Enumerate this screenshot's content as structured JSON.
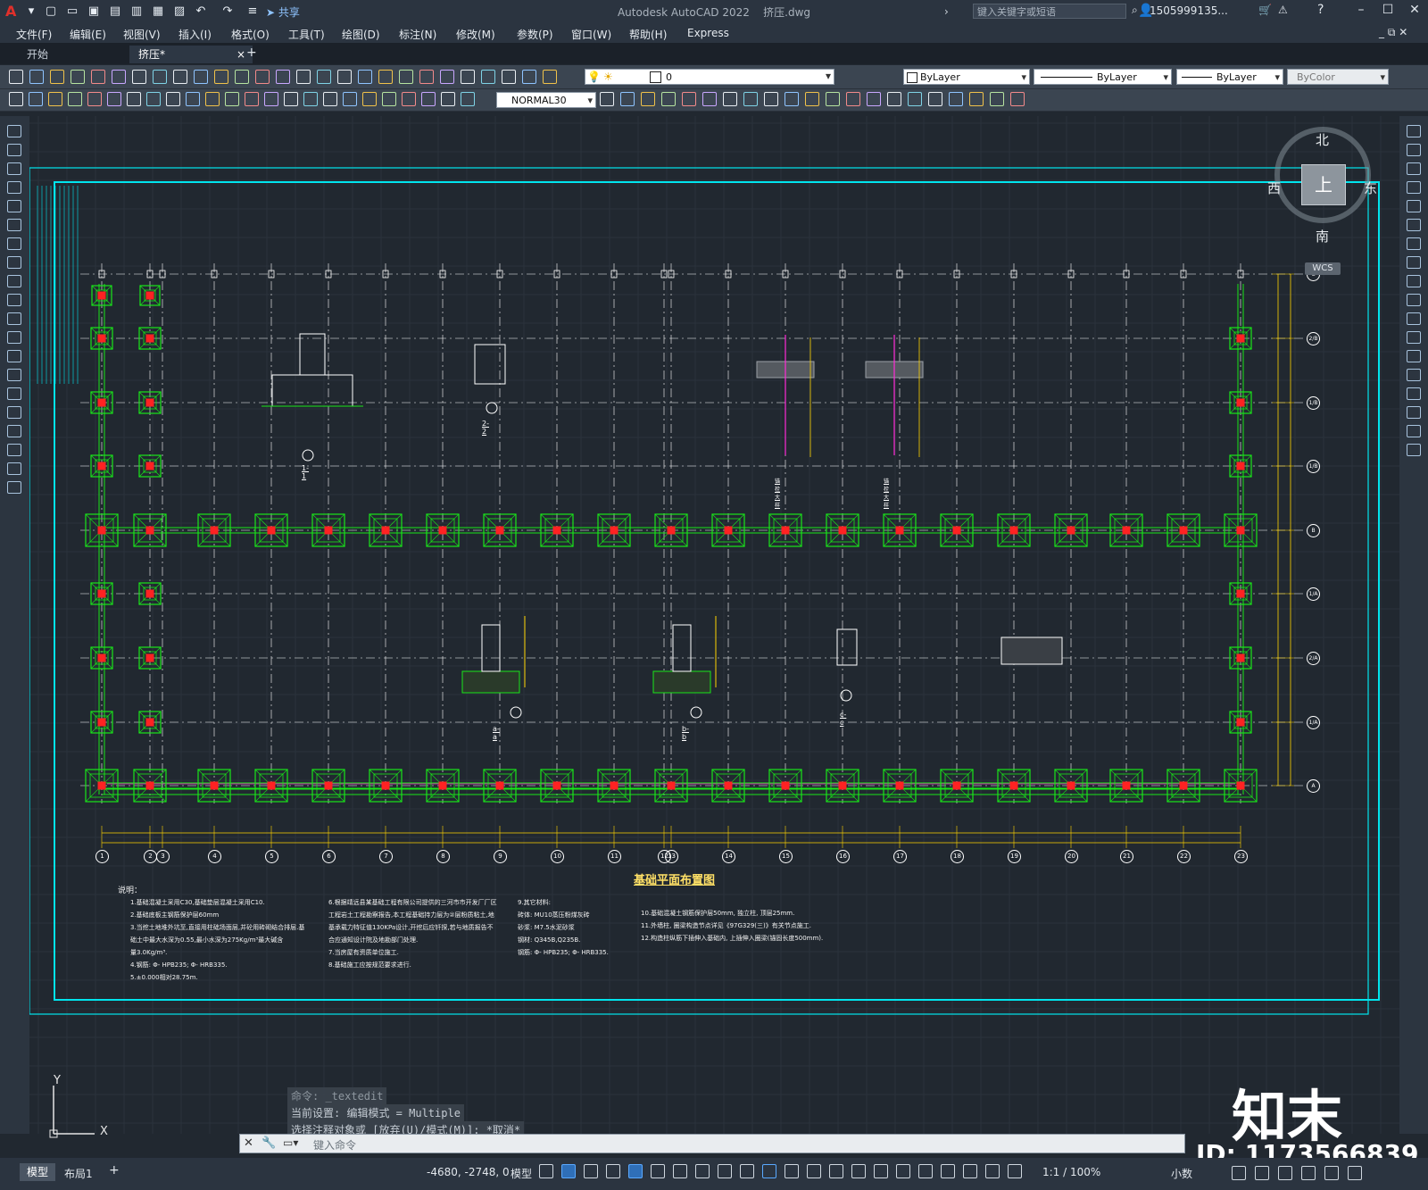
{
  "app": {
    "title": "Autodesk AutoCAD 2022",
    "file": "挤压.dwg",
    "search_placeholder": "键入关键字或短语",
    "user": "1505999135...",
    "share": "共享"
  },
  "menu": [
    "文件(F)",
    "编辑(E)",
    "视图(V)",
    "插入(I)",
    "格式(O)",
    "工具(T)",
    "绘图(D)",
    "标注(N)",
    "修改(M)",
    "参数(P)",
    "窗口(W)",
    "帮助(H)",
    "Express"
  ],
  "tabs": {
    "start": "开始",
    "active": "挤压*",
    "close": "×",
    "add": "+"
  },
  "properties": {
    "layer": "0",
    "color": "ByLayer",
    "linetype": "ByLayer",
    "lineweight": "ByLayer",
    "plotstyle": "ByColor",
    "dimstyle": "NORMAL30"
  },
  "viewcube": {
    "north": "北",
    "south": "南",
    "east": "东",
    "west": "西",
    "top": "上",
    "wcs": "WCS"
  },
  "drawing": {
    "plan_title": "基础平面布置图",
    "grid_bottom": [
      "1",
      "2",
      "3",
      "4",
      "5",
      "6",
      "7",
      "8",
      "9",
      "10",
      "11",
      "12",
      "13",
      "14",
      "15",
      "16",
      "17",
      "18",
      "19",
      "20",
      "21",
      "22",
      "23"
    ],
    "grid_right": [
      "C",
      "2/B",
      "1/B",
      "1/B",
      "B",
      "1/A",
      "2/A",
      "1/A",
      "A"
    ],
    "section_labels": [
      "1-1",
      "2-2",
      "a-a",
      "b-b",
      "c-c"
    ],
    "anchor_labels": [
      "锚栓大样",
      "锚栓大样"
    ],
    "notes_title": "说明：",
    "notes_col1": [
      "1.基础混凝土采用C30,基础垫层混凝土采用C10.",
      "2.基础底板主钢筋保护层60mm",
      "3.当挖土地堆外坑至,直接用柱础场面层,并砼用砖砌结合排层.基",
      "础土中最大水深为0.55,最小水深为275Kg/m³最大碱含",
      "量3.0Kg/m³.",
      "4.钢筋: Φ- HPB235; Φ- HRB335.",
      "5.±0.000相对28.75m."
    ],
    "notes_col2": [
      "6.根据靖远县某基础工程有限公司提供的三河市市开发厂厂区",
      "工程岩土工程勘察报告,本工程基础持力层为②层粉质粘土,地",
      "基承载力特征值130KPa设计,开挖后应钎探,若与地质报告不",
      "合应通知设计院及地勘部门处理.",
      "7.当房屋有资质单位施工.",
      "8.基础施工应按规范要求进行."
    ],
    "notes_col3": [
      "9.其它材料:",
      "砖体:  MU10蒸压粉煤灰砖",
      "砂浆:  M7.5水泥砂浆",
      "钢材:  Q345B,Q235B.",
      "钢筋: Φ- HPB235; Φ- HRB335."
    ],
    "notes_col4": [
      "10.基础混凝土钢筋保护层50mm, 独立柱, 顶层25mm.",
      "11.外墙柱, 圈梁构造节点详见《97G329(三)》有关节点施工.",
      "12.构造柱纵筋下插伸入基础内, 上插伸入圈梁(锚固长度500mm)."
    ]
  },
  "command": {
    "history": [
      "命令: _textedit",
      "当前设置: 编辑模式 = Multiple",
      "选择注释对象或 [放弃(U)/模式(M)]: *取消*"
    ],
    "prompt": "键入命令"
  },
  "ucs": {
    "x": "X",
    "y": "Y"
  },
  "status": {
    "layout_tabs": [
      "模型",
      "布局1"
    ],
    "coords": "-4680, -2748, 0",
    "model": "模型",
    "scale": "1:1 / 100%",
    "units": "小数"
  },
  "watermark": {
    "brand": "知末",
    "id": "ID: 1173566839"
  },
  "colors": {
    "bg": "#212830",
    "frame": "#00e5ee",
    "member": "#19e619",
    "axis": "#ffffff",
    "dim": "#ffd400",
    "magenta": "#ff2bd6",
    "red": "#ff2222"
  }
}
